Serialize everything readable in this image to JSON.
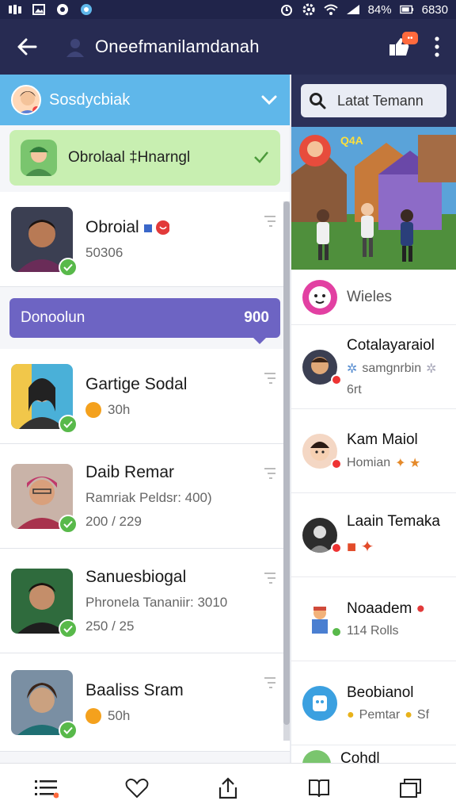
{
  "status": {
    "battery_text": "84%",
    "time": "6830"
  },
  "appbar": {
    "title": "Oneefmanilamdanah",
    "notif_badge": "••"
  },
  "left": {
    "header_title": "Sosdycbiak",
    "pinned": {
      "title": "Obrolaal ‡Hnarngl"
    },
    "banner": {
      "label": "Donoolun",
      "count": "900"
    },
    "rows": [
      {
        "name": "Obroial",
        "sub": "50306"
      },
      {
        "name": "Gartige Sodal",
        "time": "30h"
      },
      {
        "name": "Daib Remar",
        "line1": "Ramriak Peldsr: 400)",
        "line2": "200 / 229"
      },
      {
        "name": "Sanuesbiogal",
        "line1": "Phronela Tananiir: 3010",
        "line2": "250 / 25"
      },
      {
        "name": "Baaliss Sram",
        "time": "50h"
      }
    ]
  },
  "right": {
    "search_placeholder": "Latat Temann",
    "hero_sign": "Q4A",
    "items": [
      {
        "name": "Wieles"
      },
      {
        "name": "Cotalayaraiol",
        "sub": "samgnrbin",
        "sub2": "6rt"
      },
      {
        "name": "Kam Maiol",
        "sub": "Homian"
      },
      {
        "name": "Laain Temaka"
      },
      {
        "name": "Noaadem",
        "sub": "114 Rolls"
      },
      {
        "name": "Beobianol",
        "sub": "Pemtar",
        "sub_extra": "Sf"
      },
      {
        "name": "Cohdl"
      }
    ]
  },
  "colors": {
    "appbar": "#272b52",
    "header_blue": "#5fb7ea",
    "banner_purple": "#6d64c3",
    "online_green": "#58b94a"
  }
}
